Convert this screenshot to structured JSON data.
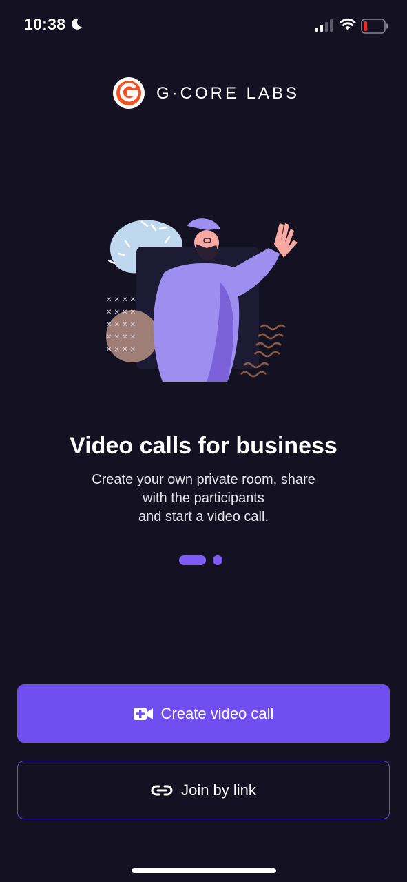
{
  "status_bar": {
    "time": "10:38",
    "icons": [
      "moon-icon",
      "signal-icon",
      "wifi-icon",
      "battery-icon"
    ]
  },
  "brand": {
    "logo_text": "G·CORE LABS",
    "accent": "#f5511e"
  },
  "onboarding": {
    "title": "Video calls for business",
    "description_lines": [
      "Create your own private room, share",
      "with the participants",
      "and start a video call."
    ],
    "page_count": 2,
    "current_page": 1
  },
  "actions": {
    "create_label": "Create video call",
    "create_icon": "video-add-icon",
    "join_label": "Join by link",
    "join_icon": "link-icon"
  },
  "colors": {
    "background": "#141222",
    "primary": "#704ef0",
    "outline": "#6a4fe0"
  }
}
